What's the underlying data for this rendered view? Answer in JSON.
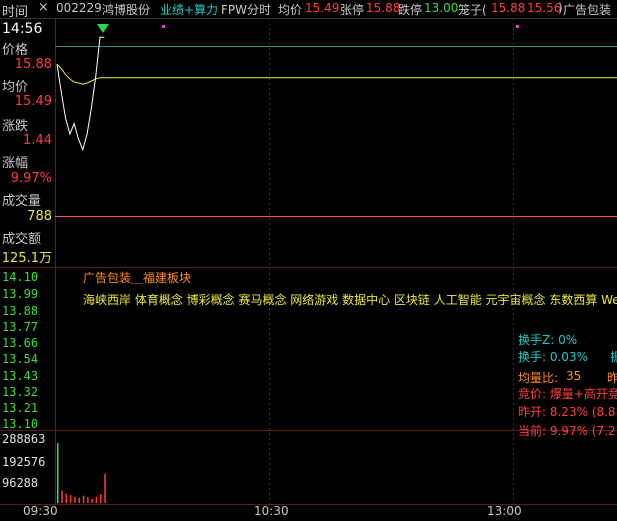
{
  "header": {
    "tab_label": "时间",
    "close_glyph": "×",
    "stock_code": "002229",
    "stock_name": "鸿博股份",
    "tag": "业绩+算力",
    "mode": "FPW分时",
    "avg_label": "均价",
    "avg_value": "15.49",
    "limit_up_label": "张停",
    "limit_up_value": "15.88",
    "limit_down_label": "跌停",
    "limit_down_value": "13.00",
    "cage_label": "笼子(",
    "cage_hi": "15.88",
    "cage_lo": "15.56",
    "cage_close": ")",
    "sector": "广告包装"
  },
  "sidebar": {
    "time": "14:56",
    "price_label": "价格",
    "price_value": "15.88",
    "avg_label": "均价",
    "avg_value": "15.49",
    "change_label": "涨跌",
    "change_value": "1.44",
    "pct_label": "涨幅",
    "pct_value": "9.97%",
    "vol_label": "成交量",
    "vol_value": "788",
    "amount_label": "成交额",
    "amount_value": "125.1万"
  },
  "price_axis": [
    "14.10",
    "13.99",
    "13.88",
    "13.77",
    "13.66",
    "13.54",
    "13.43",
    "13.32",
    "13.21",
    "13.10"
  ],
  "volume_axis": [
    "288863",
    "192576",
    "96288"
  ],
  "time_axis": [
    "09:30",
    "10:30",
    "13:00"
  ],
  "info": {
    "sector_title": "广告包装＿福建板块",
    "concepts": "海峡西岸 体育概念 博彩概念 赛马概念 网络游戏 数据中心 区块链 人工智能 元宇宙概念 东数西算 We",
    "turnover_z": "换手Z: 0%",
    "turnover": "换手: 0.03%",
    "turnover_extra": "振",
    "vol_ratio_label": "均量比:",
    "vol_ratio_value": "35",
    "vol_ratio_extra": "昨",
    "bid": "竞价: 爆量+高开竞",
    "prev_open": "昨开: 8.23% (8.8",
    "current": "当前: 9.97% (7.2"
  },
  "colors": {
    "price_line": "#ffffff",
    "avg_line": "#e8e83a",
    "up": "#ff3c3c",
    "down": "#3cdc3c",
    "accent": "#1ec8c8"
  },
  "chart_data": {
    "type": "line",
    "series": [
      {
        "values": [
          15.62,
          15.35,
          15.1,
          14.95,
          15.05,
          14.9,
          14.8,
          14.95,
          15.2,
          15.5,
          15.88,
          15.88
        ]
      },
      {
        "values": [
          15.62,
          15.58,
          15.52,
          15.48,
          15.45,
          15.44,
          15.43,
          15.44,
          15.46,
          15.48,
          15.49,
          15.49
        ]
      }
    ],
    "volume": [
      288863,
      60000,
      45000,
      38000,
      30000,
      25000,
      35000,
      28000,
      20000,
      30000,
      42000,
      140000
    ]
  }
}
